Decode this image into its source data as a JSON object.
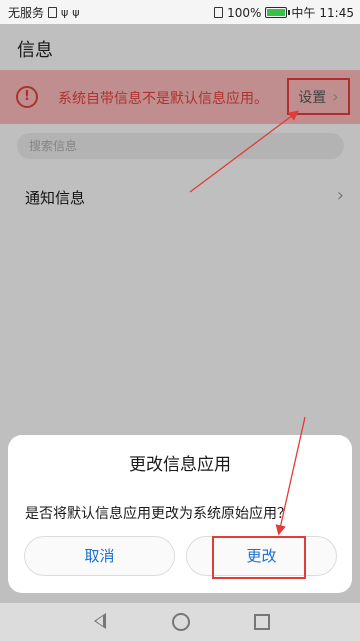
{
  "status_bar": {
    "carrier": "无服务",
    "battery_percent": "100%",
    "network": "中午",
    "time": "11:45"
  },
  "app": {
    "title": "信息"
  },
  "banner": {
    "message": "系统自带信息不是默认信息应用。",
    "settings_label": "设置"
  },
  "search": {
    "placeholder": "搜索信息"
  },
  "list": {
    "notification_label": "通知信息"
  },
  "dialog": {
    "title": "更改信息应用",
    "message": "是否将默认信息应用更改为系统原始应用？",
    "cancel_label": "取消",
    "change_label": "更改"
  },
  "colors": {
    "banner_bg": "#f6b7b6",
    "warning": "#e0413b",
    "accent": "#1a6ed6",
    "annotation": "#e03c38"
  }
}
